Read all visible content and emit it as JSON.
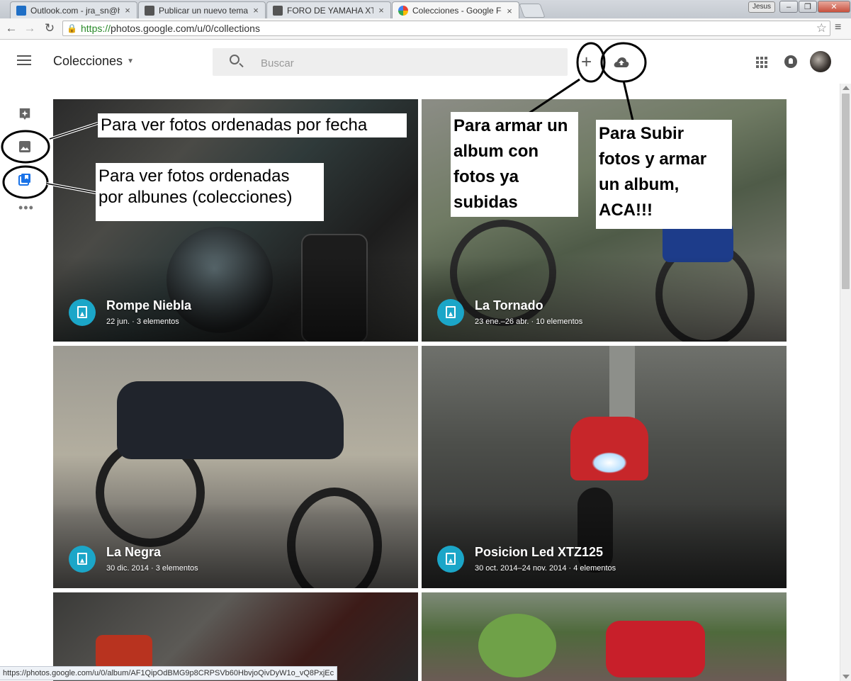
{
  "browser": {
    "tabs": [
      {
        "title": "Outlook.com - jra_sn@hot",
        "color": "#1f6fc6"
      },
      {
        "title": "Publicar un nuevo tema",
        "color": "#555555"
      },
      {
        "title": "FORO DE YAMAHA XTZ",
        "color": "#555555"
      },
      {
        "title": "Colecciones - Google Fotos",
        "color": "#e9a23b"
      }
    ],
    "user_badge": "Jesus",
    "url_scheme": "https://",
    "url_rest": "photos.google.com/u/0/collections",
    "status_url": "https://photos.google.com/u/0/album/AF1QipOdBMG9p8CRPSVb60HbvjoQivDyW1o_vQ8PxjEc"
  },
  "app": {
    "title": "Colecciones",
    "search_placeholder": "Buscar",
    "add_icon": "plus-icon",
    "upload_icon": "cloud-upload-icon"
  },
  "rail": {
    "items": [
      {
        "name": "assistant",
        "icon": "assistant-icon"
      },
      {
        "name": "photos",
        "icon": "photo-icon"
      },
      {
        "name": "collections",
        "icon": "collections-icon"
      },
      {
        "name": "more",
        "icon": "more-icon"
      }
    ]
  },
  "albums": [
    {
      "title": "Rompe Niebla",
      "date": "22 jun.",
      "count": "3 elementos"
    },
    {
      "title": "La Tornado",
      "date": "23 ene.–26 abr.",
      "count": "10 elementos"
    },
    {
      "title": "La Negra",
      "date": "30 dic. 2014",
      "count": "3 elementos"
    },
    {
      "title": "Posicion Led XTZ125",
      "date": "30 oct. 2014–24 nov. 2014",
      "count": "4 elementos"
    }
  ],
  "annotations": {
    "photos_by_date": "Para ver fotos ordenadas por fecha",
    "albums_line1": "Para ver fotos ordenadas",
    "albums_line2": "por albunes (colecciones)",
    "create_line1": "Para armar un",
    "create_line2": "album con",
    "create_line3": "fotos ya",
    "create_line4": "subidas",
    "upload_line1": "Para Subir",
    "upload_line2": "fotos y armar",
    "upload_line3": "un album,",
    "upload_line4": "ACA!!!"
  },
  "colors": {
    "accent": "#1a73e8",
    "album_icon": "#1ba6c8",
    "secure_green": "#2a8a2a"
  }
}
